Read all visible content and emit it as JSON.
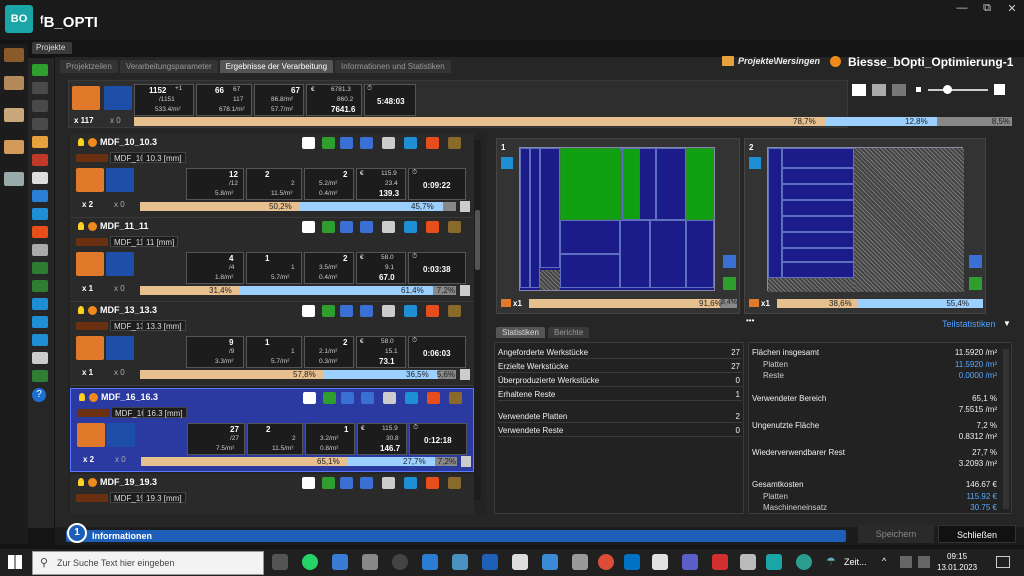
{
  "app": {
    "logo": "BO",
    "title": "ᶠB_OPTI",
    "tab": "Projekte"
  },
  "window": {
    "restore": "🗗",
    "maximize": "⧉",
    "close": "✕"
  },
  "tabs": [
    "Projektzeilen",
    "Verarbeitungsparameter",
    "Ergebnisse der Verarbeitung",
    "Informationen und Statistiken"
  ],
  "project": {
    "path": "Projekte\\Nersingen",
    "name": "Biesse_bOpti_Optimierung-1"
  },
  "summary": {
    "count": "x 117",
    "count2": "x 0",
    "a1": "1152",
    "a1s": "+1",
    "a2": "/1151",
    "a3": "533.4/m²",
    "b1": "66",
    "b2": "67",
    "b3": "117",
    "b4": "678.1/m²",
    "c1": "67",
    "c2": "86.8/m²",
    "c3": "57.7/m²",
    "d1": "6781.3",
    "d2": "860.2",
    "d3": "7641.6",
    "time": "5:48:03",
    "p1": "78,7%",
    "p2": "12,8%",
    "p3": "8,5%",
    "util": 0.787,
    "rest": 0.128
  },
  "materials": [
    {
      "name": "MDF_10_10.3",
      "label": "MDF_10",
      "thick": "10.3 [mm]",
      "x1": "x 2",
      "x0": "x 0",
      "q1": "12",
      "q2": "/12",
      "q3": "5.8/m²",
      "r1": "2",
      "r2": "2",
      "r3": "11.5/m²",
      "s1": "2",
      "s2": "5.2/m²",
      "s3": "0.4/m²",
      "e1": "115.9",
      "e2": "23.4",
      "e3": "139.3",
      "time": "0:09:22",
      "pa": "50,2%",
      "pb": "45,7%",
      "pc": "",
      "fa": 0.502,
      "fb": 0.457
    },
    {
      "name": "MDF_11_11",
      "label": "MDF_11",
      "thick": "11 [mm]",
      "x1": "x 1",
      "x0": "x 0",
      "q1": "4",
      "q2": "/4",
      "q3": "1.8/m²",
      "r1": "1",
      "r2": "1",
      "r3": "5.7/m²",
      "s1": "2",
      "s2": "3.5/m²",
      "s3": "0.4/m²",
      "e1": "58.0",
      "e2": "9.1",
      "e3": "67.0",
      "time": "0:03:38",
      "pa": "31,4%",
      "pb": "61,4%",
      "pc": "7,2%",
      "fa": 0.314,
      "fb": 0.614
    },
    {
      "name": "MDF_13_13.3",
      "label": "MDF_13",
      "thick": "13.3 [mm]",
      "x1": "x 1",
      "x0": "x 0",
      "q1": "9",
      "q2": "/9",
      "q3": "3.3/m²",
      "r1": "1",
      "r2": "1",
      "r3": "5.7/m²",
      "s1": "2",
      "s2": "2.1/m²",
      "s3": "0.3/m²",
      "e1": "58.0",
      "e2": "15.1",
      "e3": "73.1",
      "time": "0:06:03",
      "pa": "57,8%",
      "pb": "36,5%",
      "pc": "5,6%",
      "fa": 0.578,
      "fb": 0.365
    },
    {
      "name": "MDF_16_16.3",
      "label": "MDF_16",
      "thick": "16.3 [mm]",
      "x1": "x 2",
      "x0": "x 0",
      "q1": "27",
      "q2": "/27",
      "q3": "7.5/m²",
      "r1": "2",
      "r2": "2",
      "r3": "11.5/m²",
      "s1": "1",
      "s2": "3.2/m²",
      "s3": "0.8/m²",
      "e1": "115.9",
      "e2": "30.8",
      "e3": "146.7",
      "time": "0:12:18",
      "pa": "65,1%",
      "pb": "27,7%",
      "pc": "7,2%",
      "fa": 0.651,
      "fb": 0.277
    },
    {
      "name": "MDF_19_19.3",
      "label": "MDF_19",
      "thick": "19.3 [mm]"
    }
  ],
  "sheets": [
    {
      "num": "1",
      "x": "x1",
      "pa": "91,6%",
      "pb": "8,4%",
      "fa": 0.916
    },
    {
      "num": "2",
      "x": "x1",
      "pa": "38,6%",
      "pb": "55,4%",
      "fa": 0.386
    }
  ],
  "stats": {
    "tab1": "Statistiken",
    "tab2": "Berichte",
    "link": "Teilstatistiken",
    "more": "•••",
    "left": [
      {
        "label": "Angeforderte Werkstücke",
        "value": "27"
      },
      {
        "label": "Erzielte Werkstücke",
        "value": "27"
      },
      {
        "label": "Überproduzierte Werkstücke",
        "value": "0"
      },
      {
        "label": "Erhaltene Reste",
        "value": "1"
      },
      {
        "label": "Verwendete Platten",
        "value": "2"
      },
      {
        "label": "Verwendete Reste",
        "value": "0"
      }
    ],
    "right": {
      "flaechen": "Flächen insgesamt",
      "flaechen_v": "11.5920 /m²",
      "platten": "Platten",
      "platten_v": "11.5920 /m²",
      "reste": "Reste",
      "reste_v": "0.0000 /m²",
      "vb": "Verwendeter Bereich",
      "vb_p": "65,1 %",
      "vb_v": "7.5515 /m²",
      "uf": "Ungenutzte Fläche",
      "uf_p": "7,2 %",
      "uf_v": "0.8312 /m²",
      "wr": "Wiederverwendbarer Rest",
      "wr_p": "27,7 %",
      "wr_v": "3.2093 /m²",
      "gk": "Gesamtkosten",
      "gk_v": "146.67 €",
      "gp": "Platten",
      "gp_v": "115.92 €",
      "gm": "Maschineneinsatz",
      "gm_v": "30.75 €"
    }
  },
  "bottom": {
    "info_num": "1",
    "info": "Informationen",
    "save": "Speichern",
    "close": "Schließen"
  },
  "taskbar": {
    "search": "Zur Suche Text hier eingeben",
    "weather": "Zeit...",
    "time": "09:15",
    "date": "13.01.2023"
  }
}
